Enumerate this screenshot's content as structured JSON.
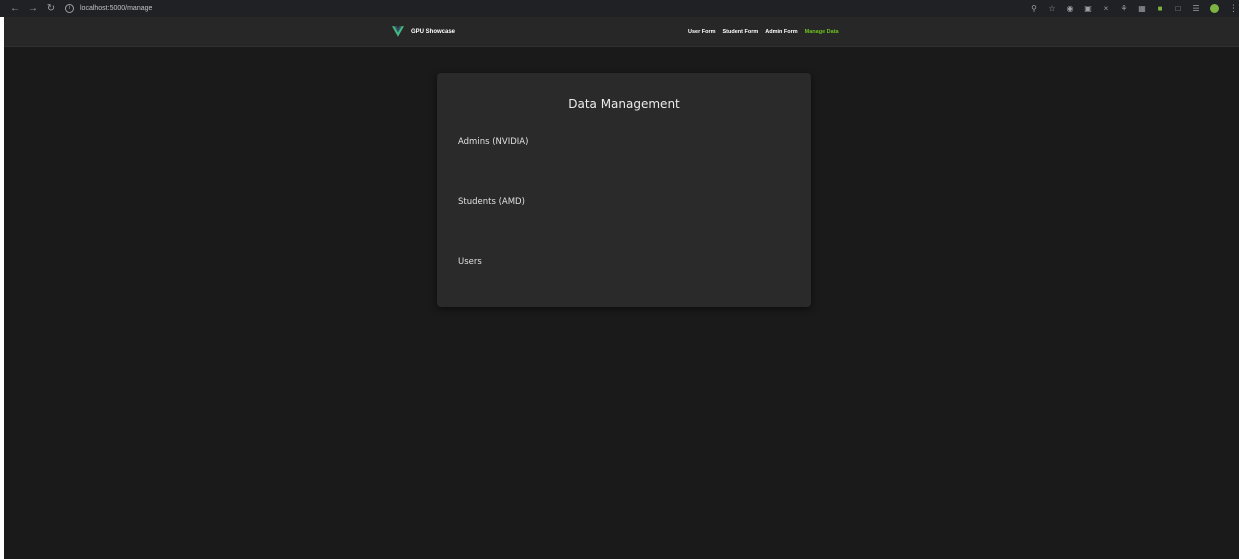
{
  "browser": {
    "url": "localhost:5000/manage",
    "back_icon": "arrow-left-icon",
    "forward_icon": "arrow-right-icon",
    "reload_icon": "reload-icon",
    "site_info_icon": "info-icon"
  },
  "header": {
    "brand": "GPU Showcase",
    "nav": [
      "User Form",
      "Student Form",
      "Admin Form",
      "Manage Data"
    ],
    "active_nav": "Manage Data",
    "accent_color": "#6cc11e"
  },
  "card": {
    "title": "Data Management",
    "sections": [
      "Admins (NVIDIA)",
      "Students (AMD)",
      "Users"
    ]
  }
}
